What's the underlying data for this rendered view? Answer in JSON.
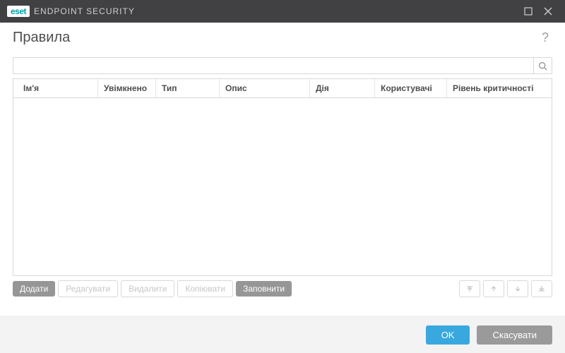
{
  "titlebar": {
    "logo_short": "eset",
    "product_name": "ENDPOINT SECURITY"
  },
  "dialog": {
    "title": "Правила"
  },
  "search": {
    "value": "",
    "placeholder": ""
  },
  "table": {
    "columns": [
      "Ім'я",
      "Увімкнено",
      "Тип",
      "Опис",
      "Дія",
      "Користувачі",
      "Рівень критичності"
    ],
    "rows": []
  },
  "toolbar": {
    "add": "Додати",
    "edit": "Редагувати",
    "delete": "Видалити",
    "copy": "Копіювати",
    "populate": "Заповнити"
  },
  "footer": {
    "ok": "OK",
    "cancel": "Скасувати"
  }
}
